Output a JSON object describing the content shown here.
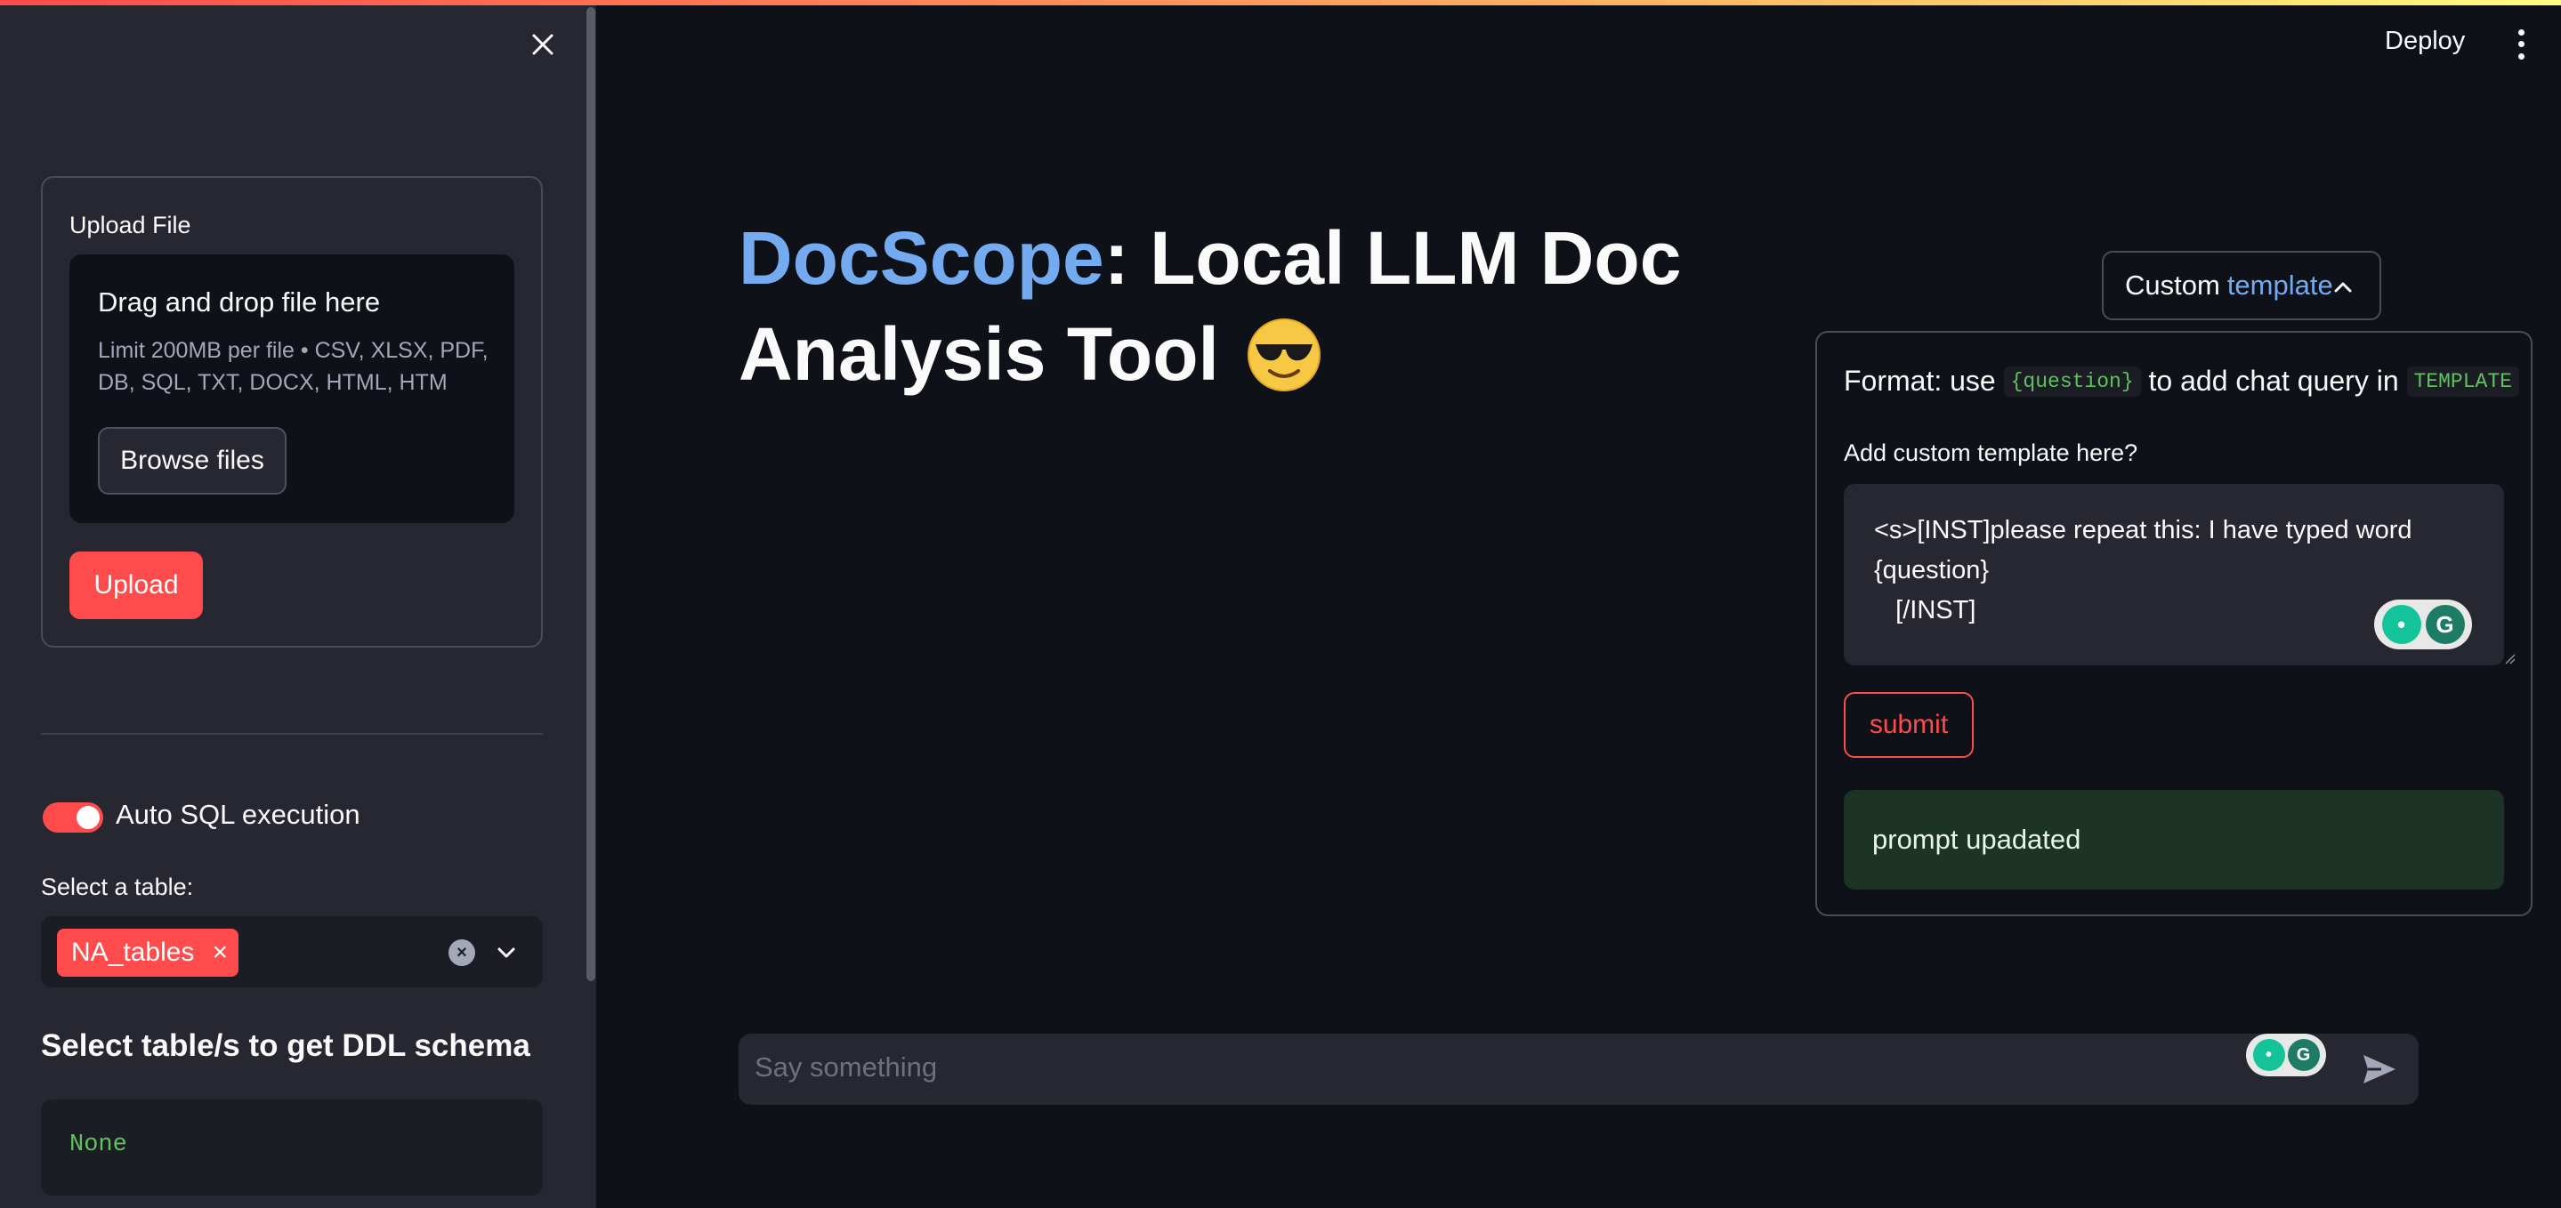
{
  "sidebar": {
    "close_icon": "close-icon",
    "upload": {
      "label": "Upload File",
      "dropzone_title": "Drag and drop file here",
      "dropzone_limit": "Limit 200MB per file • CSV, XLSX, PDF, DB, SQL, TXT, DOCX, HTML, HTM",
      "browse_label": "Browse files",
      "upload_label": "Upload"
    },
    "auto_sql": {
      "label": "Auto SQL execution",
      "enabled": true
    },
    "table_select": {
      "label": "Select a table:",
      "selected": [
        "NA_tables"
      ]
    },
    "ddl": {
      "heading": "Select table/s to get DDL schema",
      "value": "None"
    }
  },
  "header": {
    "deploy_label": "Deploy",
    "menu_icon": "kebab-menu-icon"
  },
  "main": {
    "title_brand": "DocScope",
    "title_rest": ": Local LLM Doc Analysis Tool",
    "title_emoji": "sunglasses-face-icon",
    "popover": {
      "toggle_prefix": "Custom",
      "toggle_accent": "template",
      "format_text_1": "Format: use",
      "format_code_1": "{question}",
      "format_text_2": "to add chat query in",
      "format_code_2": "TEMPLATE",
      "template_label": "Add custom template here?",
      "template_value": "<s>[INST]please repeat this: I have typed word\n{question}\n   [/INST]",
      "submit_label": "submit",
      "success_message": "prompt upadated"
    },
    "chat": {
      "placeholder": "Say something"
    }
  },
  "colors": {
    "background": "#0e1117",
    "sidebar": "#262730",
    "accent_red": "#ff4b4b",
    "brand_blue": "#73aaf0",
    "code_green": "#5fc25f",
    "success_bg": "#1d3325"
  }
}
